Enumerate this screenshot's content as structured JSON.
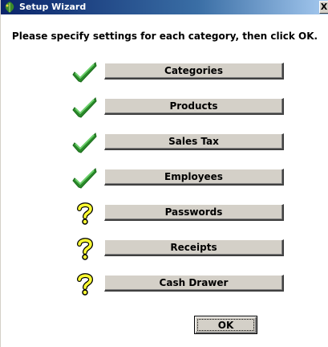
{
  "window": {
    "title": "Setup Wizard",
    "close_label": "X"
  },
  "instruction": "Please specify settings for each category, then click OK.",
  "categories": [
    {
      "label": "Categories",
      "status": "complete",
      "icon": "checkmark-icon"
    },
    {
      "label": "Products",
      "status": "complete",
      "icon": "checkmark-icon"
    },
    {
      "label": "Sales Tax",
      "status": "complete",
      "icon": "checkmark-icon"
    },
    {
      "label": "Employees",
      "status": "complete",
      "icon": "checkmark-icon"
    },
    {
      "label": "Passwords",
      "status": "incomplete",
      "icon": "question-mark-icon"
    },
    {
      "label": "Receipts",
      "status": "incomplete",
      "icon": "question-mark-icon"
    },
    {
      "label": "Cash Drawer",
      "status": "incomplete",
      "icon": "question-mark-icon"
    }
  ],
  "ok_button": {
    "label": "OK"
  },
  "colors": {
    "titlebar_start": "#0a246a",
    "titlebar_end": "#a6caf0",
    "check_green": "#2e9e2e",
    "question_yellow": "#ffff33",
    "button_face": "#d4d0c8"
  }
}
